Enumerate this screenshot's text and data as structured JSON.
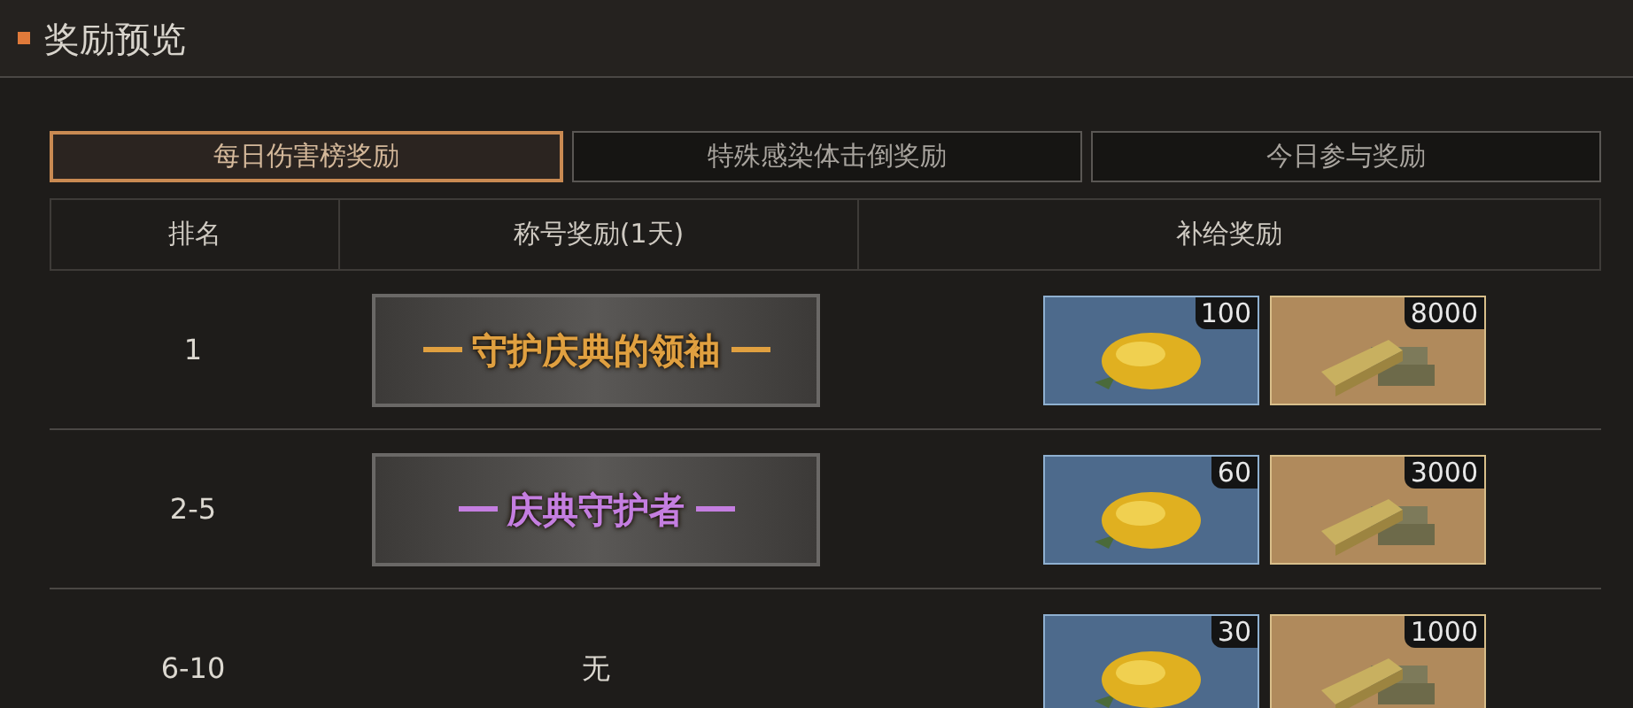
{
  "header": {
    "title": "奖励预览"
  },
  "tabs": [
    {
      "label": "每日伤害榜奖励",
      "selected": true
    },
    {
      "label": "特殊感染体击倒奖励",
      "selected": false
    },
    {
      "label": "今日参与奖励",
      "selected": false
    }
  ],
  "table": {
    "columns": [
      "排名",
      "称号奖励(1天)",
      "补给奖励"
    ],
    "rows": [
      {
        "rank": "1",
        "title": {
          "kind": "badge",
          "text": "守护庆典的领袖",
          "color": "#e0a040"
        },
        "rewards": [
          {
            "kind": "mango",
            "count": "100"
          },
          {
            "kind": "gold",
            "count": "8000"
          }
        ]
      },
      {
        "rank": "2-5",
        "title": {
          "kind": "badge",
          "text": "庆典守护者",
          "color": "#c47ee0"
        },
        "rewards": [
          {
            "kind": "mango",
            "count": "60"
          },
          {
            "kind": "gold",
            "count": "3000"
          }
        ]
      },
      {
        "rank": "6-10",
        "title": {
          "kind": "text",
          "text": "无"
        },
        "rewards": [
          {
            "kind": "mango",
            "count": "30"
          },
          {
            "kind": "gold",
            "count": "1000"
          }
        ]
      }
    ]
  }
}
